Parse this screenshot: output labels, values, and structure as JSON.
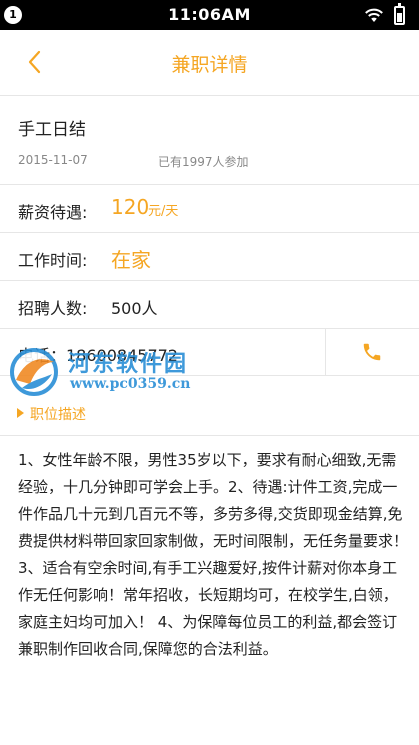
{
  "status_bar": {
    "badge": "1",
    "time": "11:06AM"
  },
  "nav": {
    "title": "兼职详情"
  },
  "job": {
    "title": "手工日结",
    "date": "2015-11-07",
    "joined": "已有1997人参加"
  },
  "salary": {
    "label": "薪资待遇:",
    "amount": "120",
    "unit": "元/天"
  },
  "work_time": {
    "label": "工作时间:",
    "value": "在家"
  },
  "recruit": {
    "label": "招聘人数:",
    "value": "500人"
  },
  "phone": {
    "text": "电话：18600845772"
  },
  "section": {
    "title": "职位描述"
  },
  "description": "1、女性年龄不限，男性35岁以下，要求有耐心细致,无需经验，十几分钟即可学会上手。2、待遇:计件工资,完成一件作品几十元到几百元不等，多劳多得,交货即现金结算,免费提供材料带回家回家制做，无时间限制，无任务量要求！3、适合有空余时间,有手工兴趣爱好,按件计薪对你本身工作无任何影响！常年招收，长短期均可，在校学生,白领，家庭主妇均可加入！ 4、为保障每位员工的利益,都会签订兼职制作回收合同,保障您的合法利益。",
  "watermark": {
    "brand": "河东软件园",
    "url": "www.pc0359.cn"
  },
  "colors": {
    "accent": "#f5a623",
    "watermark": "#2a8fd6"
  }
}
